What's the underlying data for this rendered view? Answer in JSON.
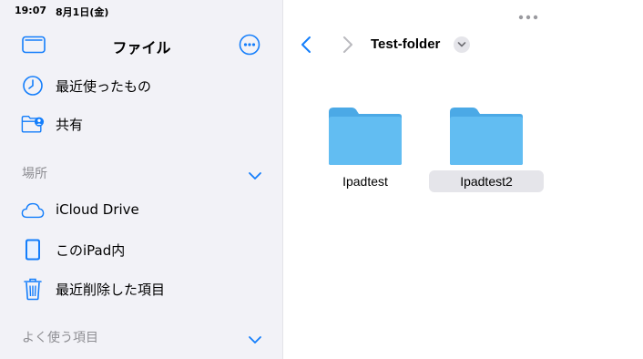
{
  "status_bar": {
    "time": "19:07",
    "date": "8月1日(金)"
  },
  "sidebar": {
    "title": "ファイル",
    "quick_items": [
      {
        "label": "最近使ったもの"
      },
      {
        "label": "共有"
      }
    ],
    "locations": {
      "header": "場所",
      "items": [
        {
          "label": "iCloud Drive"
        },
        {
          "label": "このiPad内"
        },
        {
          "label": "最近削除した項目"
        }
      ]
    },
    "favorites": {
      "header": "よく使う項目"
    }
  },
  "main": {
    "folder_title": "Test-folder",
    "items": [
      {
        "name": "Ipadtest",
        "selected": false
      },
      {
        "name": "Ipadtest2",
        "selected": true
      }
    ]
  },
  "colors": {
    "accent": "#147EFB",
    "folder": "#5FB8F0",
    "sidebar_bg": "#F2F2F7",
    "selection_bg": "#E5E5EA"
  }
}
